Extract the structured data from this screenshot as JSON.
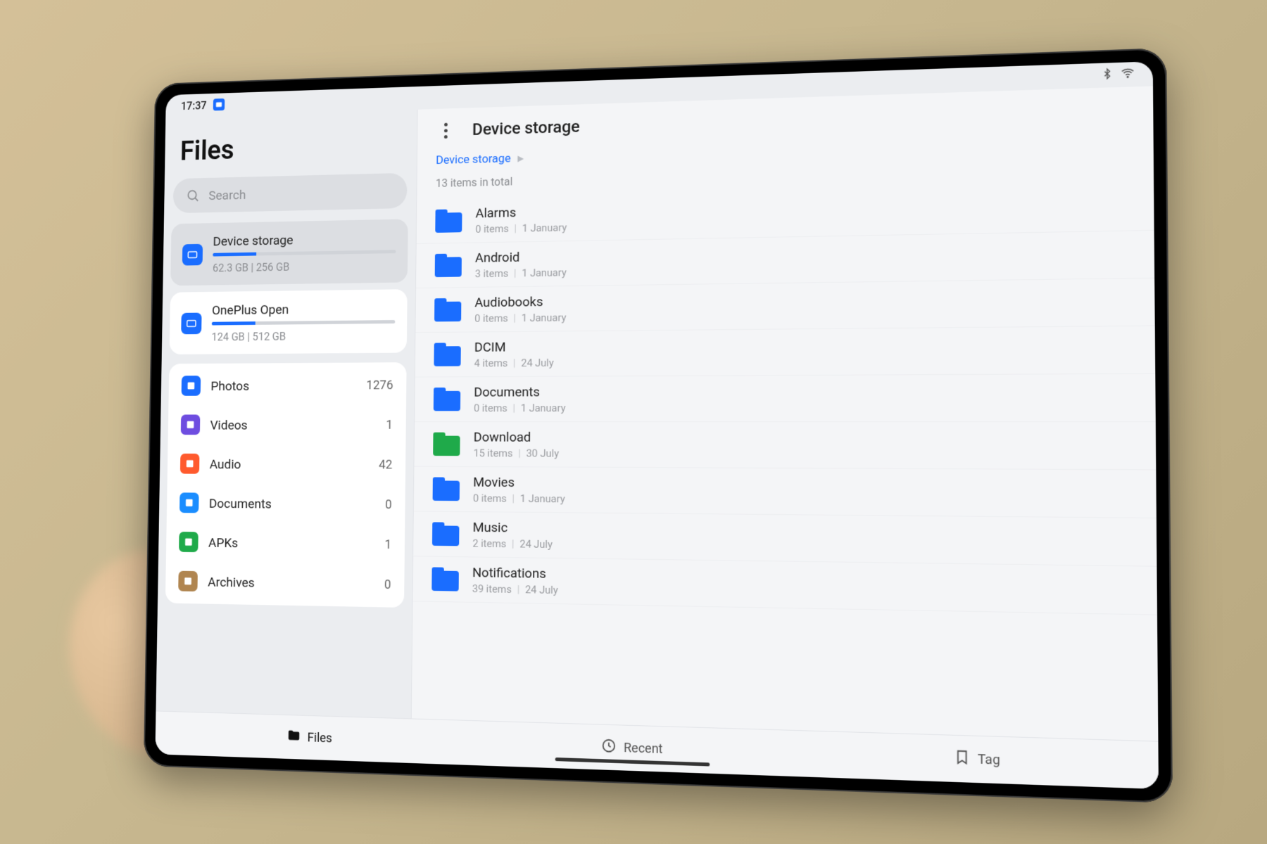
{
  "status": {
    "time": "17:37"
  },
  "app_title": "Files",
  "search_placeholder": "Search",
  "storage": [
    {
      "name": "Device storage",
      "used": "62.3 GB",
      "total": "256 GB",
      "pct": 24,
      "selected": true
    },
    {
      "name": "OnePlus Open",
      "used": "124 GB",
      "total": "512 GB",
      "pct": 24,
      "selected": false
    }
  ],
  "categories": [
    {
      "label": "Photos",
      "count": "1276",
      "color": "#1a6dff"
    },
    {
      "label": "Videos",
      "count": "1",
      "color": "#6e4de0"
    },
    {
      "label": "Audio",
      "count": "42",
      "color": "#ff5a2d"
    },
    {
      "label": "Documents",
      "count": "0",
      "color": "#1a8dff"
    },
    {
      "label": "APKs",
      "count": "1",
      "color": "#1faa4a"
    },
    {
      "label": "Archives",
      "count": "0",
      "color": "#b08550"
    }
  ],
  "main": {
    "title": "Device storage",
    "breadcrumb": "Device storage",
    "item_count": "13 items in total",
    "folders": [
      {
        "name": "Alarms",
        "items": "0 items",
        "date": "1 January"
      },
      {
        "name": "Android",
        "items": "3 items",
        "date": "1 January"
      },
      {
        "name": "Audiobooks",
        "items": "0 items",
        "date": "1 January"
      },
      {
        "name": "DCIM",
        "items": "4 items",
        "date": "24 July"
      },
      {
        "name": "Documents",
        "items": "0 items",
        "date": "1 January"
      },
      {
        "name": "Download",
        "items": "15 items",
        "date": "30 July",
        "color": "green"
      },
      {
        "name": "Movies",
        "items": "0 items",
        "date": "1 January"
      },
      {
        "name": "Music",
        "items": "2 items",
        "date": "24 July"
      },
      {
        "name": "Notifications",
        "items": "39 items",
        "date": "24 July"
      }
    ]
  },
  "bottomnav": [
    {
      "label": "Files",
      "active": true,
      "icon": "folder"
    },
    {
      "label": "Recent",
      "active": false,
      "icon": "clock"
    },
    {
      "label": "Tag",
      "active": false,
      "icon": "bookmark"
    }
  ]
}
